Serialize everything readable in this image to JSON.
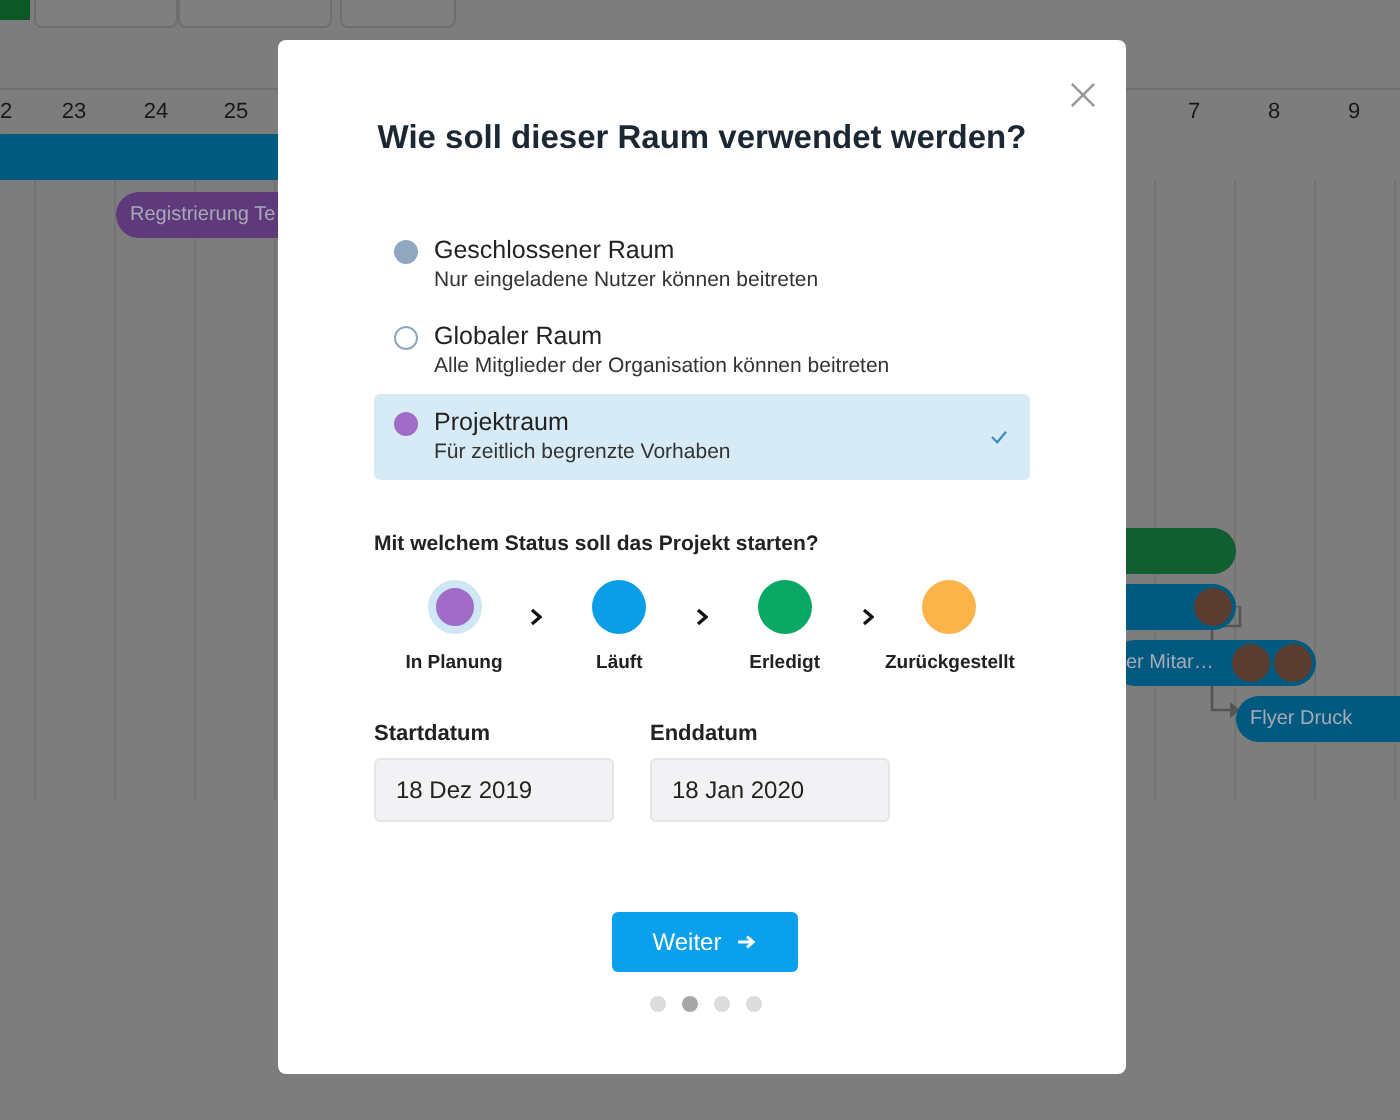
{
  "timeline": {
    "days": [
      "2",
      "23",
      "24",
      "25",
      "7",
      "8",
      "9"
    ],
    "bars": [
      {
        "color": "#005a80"
      },
      {
        "label": "Registrierung Te",
        "color": "#5e3a7a"
      },
      {
        "color": "#115e30"
      },
      {
        "color": "#005a80"
      },
      {
        "label": "er Mitar…",
        "color": "#005a80"
      },
      {
        "label": "Flyer Druck",
        "color": "#005a80"
      }
    ]
  },
  "dialog": {
    "title": "Wie soll dieser Raum verwendet werden?",
    "rooms": [
      {
        "kind": "filled",
        "title": "Geschlossener Raum",
        "description": "Nur eingeladene Nutzer können beitreten",
        "color": "#8fa8c0",
        "selected": false
      },
      {
        "kind": "outline",
        "title": "Globaler Raum",
        "description": "Alle Mitglieder der Organisation können beitreten",
        "color": "#8fa8c0",
        "selected": false
      },
      {
        "kind": "filled",
        "title": "Projektraum",
        "description": "Für zeitlich begrenzte Vorhaben",
        "color": "#a06cc8",
        "selected": true
      }
    ],
    "status_question": "Mit welchem Status soll das Projekt starten?",
    "statuses": [
      {
        "label": "In Planung",
        "color": "#a06cc8",
        "selected": true
      },
      {
        "label": "Läuft",
        "color": "#0a9ee6",
        "selected": false
      },
      {
        "label": "Erledigt",
        "color": "#0aa864",
        "selected": false
      },
      {
        "label": "Zurückgestellt",
        "color": "#fbb44a",
        "selected": false
      }
    ],
    "start": {
      "label": "Startdatum",
      "value": "18 Dez 2019"
    },
    "end": {
      "label": "Enddatum",
      "value": "18 Jan 2020"
    },
    "next_button": "Weiter",
    "steps": [
      {
        "selected": false
      },
      {
        "selected": true
      },
      {
        "selected": false
      },
      {
        "selected": false
      }
    ]
  }
}
